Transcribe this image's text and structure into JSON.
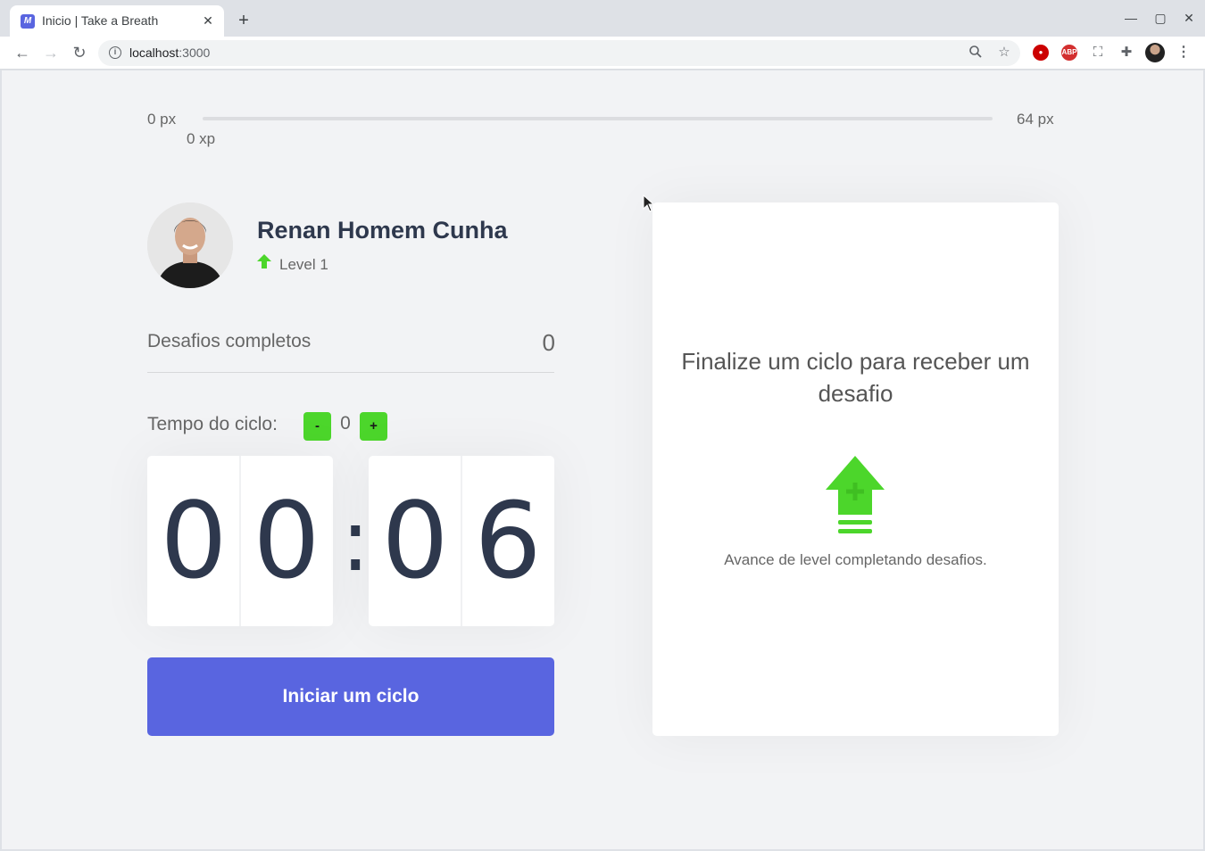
{
  "browser": {
    "tab_title": "Inicio | Take a Breath",
    "tab_favicon": "M",
    "url_host": "localhost",
    "url_port": ":3000",
    "extensions": [
      "ublock",
      "ABP"
    ]
  },
  "xp_bar": {
    "min_label": "0 px",
    "max_label": "64 px",
    "current_label": "0 xp",
    "progress": 0
  },
  "profile": {
    "name": "Renan Homem Cunha",
    "level_label": "Level 1"
  },
  "completed": {
    "label": "Desafios completos",
    "value": "0"
  },
  "cycle": {
    "label": "Tempo do ciclo:",
    "minus_label": "-",
    "plus_label": "+",
    "value": "0"
  },
  "countdown": {
    "minute_tens": "0",
    "minute_ones": "0",
    "separator": ":",
    "second_tens": "0",
    "second_ones": "6"
  },
  "start_button_label": "Iniciar um ciclo",
  "challenge": {
    "title": "Finalize um ciclo para receber um desafio",
    "hint": "Avance de level completando desafios."
  },
  "colors": {
    "accent": "#5965e0",
    "green": "#4cd62b",
    "title_text": "#2e384d",
    "text": "#666666",
    "background": "#f2f3f5"
  }
}
